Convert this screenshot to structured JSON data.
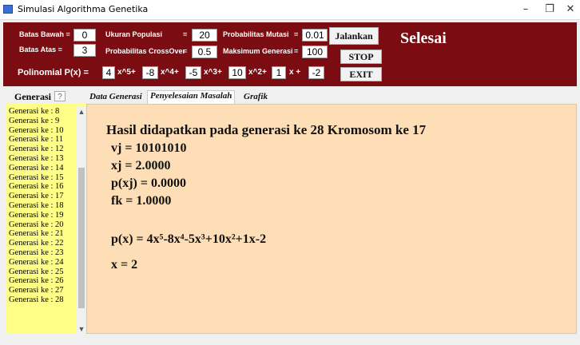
{
  "window": {
    "title": "Simulasi Algorithma Genetika",
    "controls": [
      "–",
      "❐",
      "✕"
    ]
  },
  "params": {
    "batas_bawah_label": "Batas Bawah =",
    "batas_bawah": "0",
    "batas_atas_label": "Batas Atas =",
    "batas_atas": "3",
    "ukuran_populasi_label": "Ukuran Populasi",
    "ukuran_populasi_eq": "=",
    "ukuran_populasi": "20",
    "prob_crossover_label": "Probabilitas CrossOver",
    "prob_crossover_eq": "=",
    "prob_crossover": "0.5",
    "prob_mutasi_label": "Probabilitas Mutasi",
    "prob_mutasi_eq": "=",
    "prob_mutasi": "0.01",
    "maks_generasi_label": "Maksimum Generasi",
    "maks_generasi_eq": "=",
    "maks_generasi": "100"
  },
  "polinomial": {
    "label": "Polinomial P(x) =",
    "c5": "4",
    "t5": "x^5+",
    "c4": "-8",
    "t4": "x^4+",
    "c3": "-5",
    "t3": "x^3+",
    "c2": "10",
    "t2": "x^2+",
    "c1": "1",
    "t1": "x +",
    "c0": "-2"
  },
  "buttons": {
    "jalankan": "Jalankan",
    "stop": "STOP",
    "exit": "EXIT"
  },
  "status_title": "Selesai",
  "left_panel": {
    "title": "Generasi",
    "help": "?",
    "items": [
      "Generasi ke : 8",
      "Generasi ke : 9",
      "Generasi ke : 10",
      "Generasi ke : 11",
      "Generasi ke : 12",
      "Generasi ke : 13",
      "Generasi ke : 14",
      "Generasi ke : 15",
      "Generasi ke : 16",
      "Generasi ke : 17",
      "Generasi ke : 18",
      "Generasi ke : 19",
      "Generasi ke : 20",
      "Generasi ke : 21",
      "Generasi ke : 22",
      "Generasi ke : 23",
      "Generasi ke : 24",
      "Generasi ke : 25",
      "Generasi ke : 26",
      "Generasi ke : 27",
      "Generasi ke : 28"
    ]
  },
  "tabs": [
    "Data Generasi",
    "Penyelesaian Masalah",
    "Grafik"
  ],
  "result": {
    "headline": "Hasil didapatkan pada generasi ke 28 Kromosom ke 17",
    "vj": "vj = 10101010",
    "xj": "xj = 2.0000",
    "pxj": "p(xj) = 0.0000",
    "fk": "fk = 1.0000",
    "poly": "p(x) = 4x⁵-8x⁴-5x³+10x²+1x-2",
    "x": "x = 2"
  },
  "colors": {
    "header_bg": "#7b0d12",
    "list_bg": "#ffff88",
    "content_bg": "#fedeb6"
  }
}
